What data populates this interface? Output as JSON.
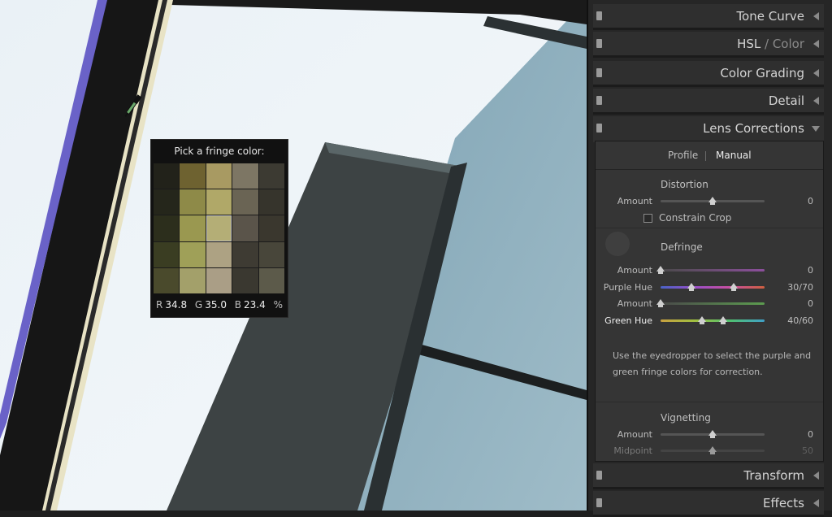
{
  "fringe_picker": {
    "title": "Pick a fringe color:",
    "swatches": [
      [
        "#22221a",
        "#6e6230",
        "#a89a62",
        "#7d7664",
        "#3c3a32"
      ],
      [
        "#25261b",
        "#8e8a48",
        "#b0a868",
        "#6a6454",
        "#36342c"
      ],
      [
        "#2c2e1c",
        "#9a9850",
        "#b4ae76",
        "#5a544a",
        "#3a372e"
      ],
      [
        "#3a3d22",
        "#9fa058",
        "#ada283",
        "#3e3b33",
        "#48463a"
      ],
      [
        "#4a4a2c",
        "#a3a06a",
        "#aa9e86",
        "#3a3830",
        "#5c5a4a"
      ]
    ],
    "readout": {
      "r_label": "R",
      "r_value": "34.8",
      "g_label": "G",
      "g_value": "35.0",
      "b_label": "B",
      "b_value": "23.4",
      "unit": "%"
    }
  },
  "panel": {
    "sections": {
      "tone_curve": "Tone Curve",
      "hsl": "HSL",
      "hsl_sep": " / ",
      "color": "Color",
      "color_grading": "Color Grading",
      "detail": "Detail",
      "lens_corrections": "Lens Corrections",
      "transform": "Transform",
      "effects": "Effects"
    },
    "tabs": {
      "profile": "Profile",
      "manual": "Manual"
    },
    "distortion": {
      "label": "Distortion",
      "amount_label": "Amount",
      "amount_value": "0",
      "amount_position": 0.5,
      "constrain_crop": "Constrain Crop"
    },
    "defringe": {
      "label": "Defringe",
      "purple_amount_label": "Amount",
      "purple_amount_value": "0",
      "purple_amount_position": 0.0,
      "purple_hue_label": "Purple Hue",
      "purple_hue_value": "30/70",
      "purple_hue_low": 0.3,
      "purple_hue_high": 0.7,
      "green_amount_label": "Amount",
      "green_amount_value": "0",
      "green_amount_position": 0.0,
      "green_hue_label": "Green Hue",
      "green_hue_value": "40/60",
      "green_hue_low": 0.4,
      "green_hue_high": 0.6,
      "help": "Use the eyedropper to select the purple and green fringe colors for correction."
    },
    "vignetting": {
      "label": "Vignetting",
      "amount_label": "Amount",
      "amount_value": "0",
      "amount_position": 0.5,
      "midpoint_label": "Midpoint",
      "midpoint_value": "50",
      "midpoint_position": 0.5
    }
  }
}
